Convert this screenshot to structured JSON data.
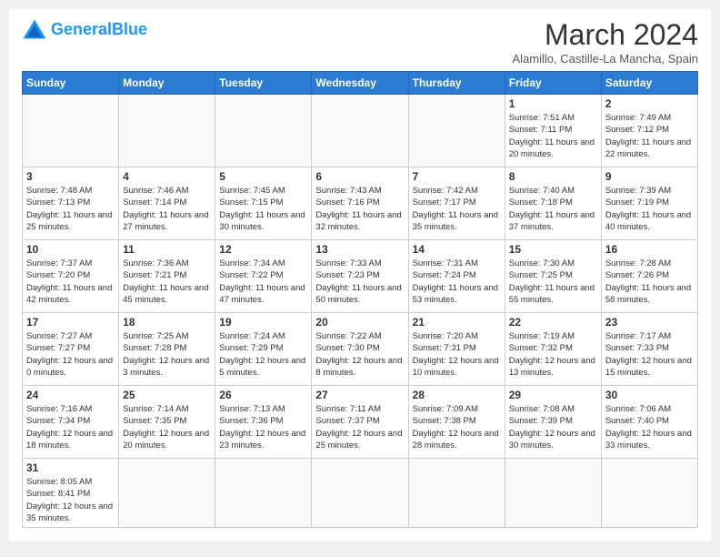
{
  "logo": {
    "general": "General",
    "blue": "Blue"
  },
  "title": "March 2024",
  "subtitle": "Alamillo, Castille-La Mancha, Spain",
  "headers": [
    "Sunday",
    "Monday",
    "Tuesday",
    "Wednesday",
    "Thursday",
    "Friday",
    "Saturday"
  ],
  "weeks": [
    [
      {
        "day": "",
        "info": ""
      },
      {
        "day": "",
        "info": ""
      },
      {
        "day": "",
        "info": ""
      },
      {
        "day": "",
        "info": ""
      },
      {
        "day": "",
        "info": ""
      },
      {
        "day": "1",
        "info": "Sunrise: 7:51 AM\nSunset: 7:11 PM\nDaylight: 11 hours and 20 minutes."
      },
      {
        "day": "2",
        "info": "Sunrise: 7:49 AM\nSunset: 7:12 PM\nDaylight: 11 hours and 22 minutes."
      }
    ],
    [
      {
        "day": "3",
        "info": "Sunrise: 7:48 AM\nSunset: 7:13 PM\nDaylight: 11 hours and 25 minutes."
      },
      {
        "day": "4",
        "info": "Sunrise: 7:46 AM\nSunset: 7:14 PM\nDaylight: 11 hours and 27 minutes."
      },
      {
        "day": "5",
        "info": "Sunrise: 7:45 AM\nSunset: 7:15 PM\nDaylight: 11 hours and 30 minutes."
      },
      {
        "day": "6",
        "info": "Sunrise: 7:43 AM\nSunset: 7:16 PM\nDaylight: 11 hours and 32 minutes."
      },
      {
        "day": "7",
        "info": "Sunrise: 7:42 AM\nSunset: 7:17 PM\nDaylight: 11 hours and 35 minutes."
      },
      {
        "day": "8",
        "info": "Sunrise: 7:40 AM\nSunset: 7:18 PM\nDaylight: 11 hours and 37 minutes."
      },
      {
        "day": "9",
        "info": "Sunrise: 7:39 AM\nSunset: 7:19 PM\nDaylight: 11 hours and 40 minutes."
      }
    ],
    [
      {
        "day": "10",
        "info": "Sunrise: 7:37 AM\nSunset: 7:20 PM\nDaylight: 11 hours and 42 minutes."
      },
      {
        "day": "11",
        "info": "Sunrise: 7:36 AM\nSunset: 7:21 PM\nDaylight: 11 hours and 45 minutes."
      },
      {
        "day": "12",
        "info": "Sunrise: 7:34 AM\nSunset: 7:22 PM\nDaylight: 11 hours and 47 minutes."
      },
      {
        "day": "13",
        "info": "Sunrise: 7:33 AM\nSunset: 7:23 PM\nDaylight: 11 hours and 50 minutes."
      },
      {
        "day": "14",
        "info": "Sunrise: 7:31 AM\nSunset: 7:24 PM\nDaylight: 11 hours and 53 minutes."
      },
      {
        "day": "15",
        "info": "Sunrise: 7:30 AM\nSunset: 7:25 PM\nDaylight: 11 hours and 55 minutes."
      },
      {
        "day": "16",
        "info": "Sunrise: 7:28 AM\nSunset: 7:26 PM\nDaylight: 11 hours and 58 minutes."
      }
    ],
    [
      {
        "day": "17",
        "info": "Sunrise: 7:27 AM\nSunset: 7:27 PM\nDaylight: 12 hours and 0 minutes."
      },
      {
        "day": "18",
        "info": "Sunrise: 7:25 AM\nSunset: 7:28 PM\nDaylight: 12 hours and 3 minutes."
      },
      {
        "day": "19",
        "info": "Sunrise: 7:24 AM\nSunset: 7:29 PM\nDaylight: 12 hours and 5 minutes."
      },
      {
        "day": "20",
        "info": "Sunrise: 7:22 AM\nSunset: 7:30 PM\nDaylight: 12 hours and 8 minutes."
      },
      {
        "day": "21",
        "info": "Sunrise: 7:20 AM\nSunset: 7:31 PM\nDaylight: 12 hours and 10 minutes."
      },
      {
        "day": "22",
        "info": "Sunrise: 7:19 AM\nSunset: 7:32 PM\nDaylight: 12 hours and 13 minutes."
      },
      {
        "day": "23",
        "info": "Sunrise: 7:17 AM\nSunset: 7:33 PM\nDaylight: 12 hours and 15 minutes."
      }
    ],
    [
      {
        "day": "24",
        "info": "Sunrise: 7:16 AM\nSunset: 7:34 PM\nDaylight: 12 hours and 18 minutes."
      },
      {
        "day": "25",
        "info": "Sunrise: 7:14 AM\nSunset: 7:35 PM\nDaylight: 12 hours and 20 minutes."
      },
      {
        "day": "26",
        "info": "Sunrise: 7:13 AM\nSunset: 7:36 PM\nDaylight: 12 hours and 23 minutes."
      },
      {
        "day": "27",
        "info": "Sunrise: 7:11 AM\nSunset: 7:37 PM\nDaylight: 12 hours and 25 minutes."
      },
      {
        "day": "28",
        "info": "Sunrise: 7:09 AM\nSunset: 7:38 PM\nDaylight: 12 hours and 28 minutes."
      },
      {
        "day": "29",
        "info": "Sunrise: 7:08 AM\nSunset: 7:39 PM\nDaylight: 12 hours and 30 minutes."
      },
      {
        "day": "30",
        "info": "Sunrise: 7:06 AM\nSunset: 7:40 PM\nDaylight: 12 hours and 33 minutes."
      }
    ],
    [
      {
        "day": "31",
        "info": "Sunrise: 8:05 AM\nSunset: 8:41 PM\nDaylight: 12 hours and 35 minutes."
      },
      {
        "day": "",
        "info": ""
      },
      {
        "day": "",
        "info": ""
      },
      {
        "day": "",
        "info": ""
      },
      {
        "day": "",
        "info": ""
      },
      {
        "day": "",
        "info": ""
      },
      {
        "day": "",
        "info": ""
      }
    ]
  ]
}
